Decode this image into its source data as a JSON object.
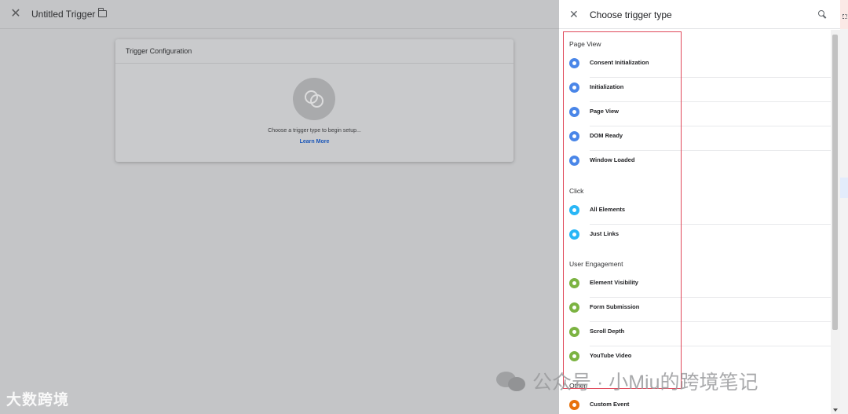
{
  "editor": {
    "close_icon": "close-icon",
    "title": "Untitled Trigger",
    "folder_icon": "folder-icon",
    "card": {
      "header": "Trigger Configuration",
      "prompt": "Choose a trigger type to begin setup...",
      "link": "Learn More"
    }
  },
  "panel": {
    "title": "Choose trigger type",
    "sections": [
      {
        "title": "Page View",
        "items": [
          {
            "label": "Consent Initialization",
            "color": "#4a86e8",
            "icon": "shield-icon"
          },
          {
            "label": "Initialization",
            "color": "#4a86e8",
            "icon": "power-icon"
          },
          {
            "label": "Page View",
            "color": "#4a86e8",
            "icon": "eye-icon"
          },
          {
            "label": "DOM Ready",
            "color": "#4a86e8",
            "icon": "document-icon"
          },
          {
            "label": "Window Loaded",
            "color": "#4a86e8",
            "icon": "window-icon"
          }
        ]
      },
      {
        "title": "Click",
        "items": [
          {
            "label": "All Elements",
            "color": "#29b6f6",
            "icon": "mouse-icon"
          },
          {
            "label": "Just Links",
            "color": "#29b6f6",
            "icon": "link-icon"
          }
        ]
      },
      {
        "title": "User Engagement",
        "items": [
          {
            "label": "Element Visibility",
            "color": "#7cb342",
            "icon": "eye-icon"
          },
          {
            "label": "Form Submission",
            "color": "#7cb342",
            "icon": "form-icon"
          },
          {
            "label": "Scroll Depth",
            "color": "#7cb342",
            "icon": "scroll-icon"
          },
          {
            "label": "YouTube Video",
            "color": "#7cb342",
            "icon": "play-icon"
          }
        ]
      },
      {
        "title": "Other",
        "items": [
          {
            "label": "Custom Event",
            "color": "#e8710a",
            "icon": "code-icon"
          }
        ]
      }
    ]
  },
  "watermark": {
    "left": "大数跨境",
    "right": "公众号 · 小Miu的跨境笔记"
  }
}
